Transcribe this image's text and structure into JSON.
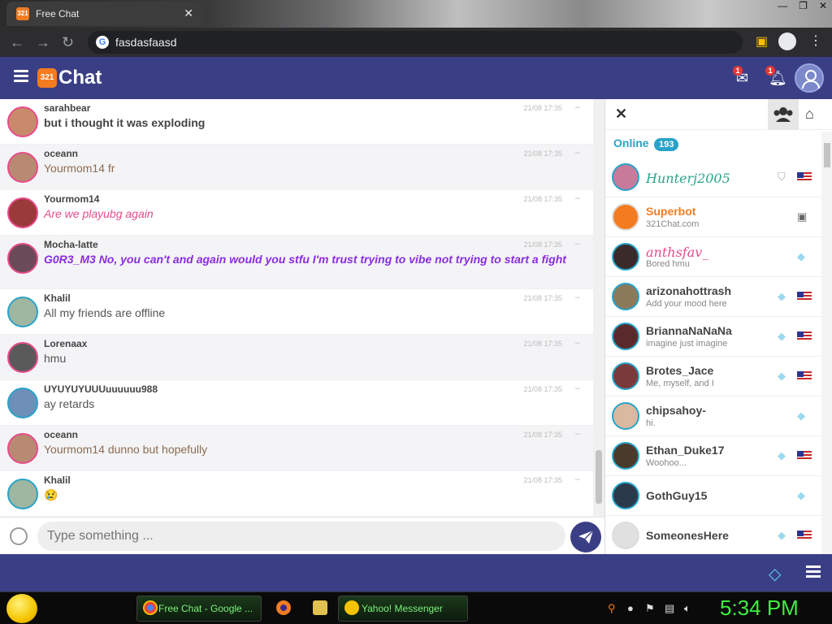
{
  "browser": {
    "tab_title": "Free Chat",
    "tab_favicon": "321",
    "url": "fasdasfaasd"
  },
  "app": {
    "logo_mark": "321",
    "logo_text": "Chat",
    "mail_badge": "1",
    "notif_badge": "1"
  },
  "messages": [
    {
      "user": "sarahbear",
      "text": "but i thought it was exploding",
      "time": "21/08 17:35",
      "style": "bold",
      "avatar_color": "#c98a6b"
    },
    {
      "user": "oceann",
      "text": "Yourmom14 fr",
      "time": "21/08 17:35",
      "style": "brown",
      "avatar_color": "#b98a72"
    },
    {
      "user": "Yourmom14",
      "text": "Are we playubg again",
      "time": "21/08 17:35",
      "style": "pink",
      "avatar_color": "#9a3a3a"
    },
    {
      "user": "Mocha-latte",
      "text": "G0R3_M3 No, you can't and again would you stfu I'm trust trying to vibe not trying to start a fight",
      "time": "21/08 17:35",
      "style": "purple",
      "avatar_color": "#6a4b57"
    },
    {
      "user": "Khalil",
      "text": "All my friends are offline",
      "time": "21/08 17:35",
      "style": "normal",
      "avatar_color": "#9fb6a0"
    },
    {
      "user": "Lorenaax",
      "text": "hmu",
      "time": "21/08 17:35",
      "style": "normal",
      "avatar_color": "#5a5a5a"
    },
    {
      "user": "UYUYUYUUUuuuuuu988",
      "text": "ay retards",
      "time": "21/08 17:35",
      "style": "normal",
      "avatar_color": "#6e8fb8"
    },
    {
      "user": "oceann",
      "text": "Yourmom14 dunno but hopefully",
      "time": "21/08 17:35",
      "style": "brown",
      "avatar_color": "#b98a72"
    },
    {
      "user": "Khalil",
      "text": "😢",
      "time": "21/08 17:35",
      "style": "normal",
      "avatar_color": "#9fb6a0"
    }
  ],
  "input": {
    "placeholder": "Type something ..."
  },
  "panel": {
    "online_label": "Online",
    "online_count": "193",
    "users": [
      {
        "name": "Hunterj2005",
        "mood": "",
        "name_color": "#2aa58b",
        "icon": "shield-icon",
        "flag": true,
        "avatar_color": "#c77a9a"
      },
      {
        "name": "Superbot",
        "mood": "321Chat.com",
        "name_color": "#f47c20",
        "icon": "android-icon",
        "flag": false,
        "avatar_color": "#f47c20"
      },
      {
        "name": "anthsfav_",
        "mood": "Bored hmu",
        "name_color": "#e84a8a",
        "icon": "diamond-icon",
        "flag": false,
        "avatar_color": "#3a2a2a"
      },
      {
        "name": "arizonahottrash",
        "mood": "Add your mood here",
        "name_color": "#444444",
        "icon": "diamond-icon",
        "flag": true,
        "avatar_color": "#8a7a5a"
      },
      {
        "name": "BriannaNaNaNa",
        "mood": "imagine just imagine",
        "name_color": "#444444",
        "icon": "diamond-icon",
        "flag": true,
        "avatar_color": "#5a2a2a"
      },
      {
        "name": "Brotes_Jace",
        "mood": "Me, myself, and I",
        "name_color": "#444444",
        "icon": "diamond-icon",
        "flag": true,
        "avatar_color": "#7a3a3a"
      },
      {
        "name": "chipsahoy-",
        "mood": "hi.",
        "name_color": "#444444",
        "icon": "diamond-icon",
        "flag": false,
        "avatar_color": "#d9b9a0"
      },
      {
        "name": "Ethan_Duke17",
        "mood": "Woohoo...",
        "name_color": "#444444",
        "icon": "diamond-icon",
        "flag": true,
        "avatar_color": "#4a3a2a"
      },
      {
        "name": "GothGuy15",
        "mood": "",
        "name_color": "#444444",
        "icon": "diamond-icon",
        "flag": false,
        "avatar_color": "#2a3a4a"
      },
      {
        "name": "SomeonesHere",
        "mood": "",
        "name_color": "#444444",
        "icon": "diamond-icon",
        "flag": true,
        "avatar_color": "#e0e0e0"
      }
    ]
  },
  "taskbar": {
    "item1": "Free Chat - Google ...",
    "item2": "Yahoo! Messenger",
    "clock": "5:34 PM"
  }
}
